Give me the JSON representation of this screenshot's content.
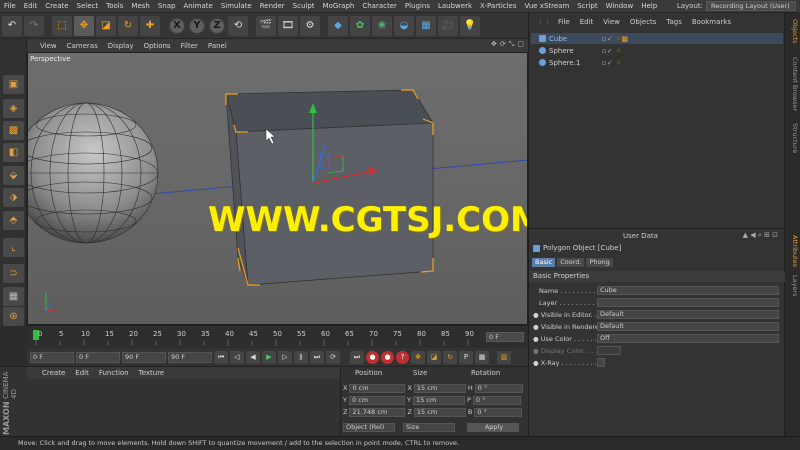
{
  "menubar": {
    "items": [
      "File",
      "Edit",
      "Create",
      "Select",
      "Tools",
      "Mesh",
      "Snap",
      "Animate",
      "Simulate",
      "Render",
      "Sculpt",
      "MoGraph",
      "Character",
      "Plugins",
      "Laubwerk",
      "X-Particles",
      "Vue xStream",
      "Script",
      "Window",
      "Help"
    ],
    "layout_label": "Layout:",
    "layout_value": "Recording Layout (User)"
  },
  "toolbar": {
    "x": "X",
    "y": "Y",
    "z": "Z"
  },
  "viewport": {
    "menu": [
      "View",
      "Cameras",
      "Display",
      "Options",
      "Filter",
      "Panel"
    ],
    "label": "Perspective",
    "watermark": "WWW.CGTSJ.COM"
  },
  "timeline": {
    "ticks": [
      "0",
      "5",
      "10",
      "15",
      "20",
      "25",
      "30",
      "35",
      "40",
      "45",
      "50",
      "55",
      "60",
      "65",
      "70",
      "75",
      "80",
      "85",
      "90"
    ],
    "current_frame": "0 F"
  },
  "transport": {
    "start": "0 F",
    "preview_start": "0 F",
    "preview_end": "90 F",
    "end": "90 F"
  },
  "materials": {
    "menu": [
      "Create",
      "Edit",
      "Function",
      "Texture"
    ],
    "logo_top": "MAXON",
    "logo_bottom": "CINEMA 4D"
  },
  "coordinates": {
    "headers": [
      "Position",
      "Size",
      "Rotation"
    ],
    "rows": [
      {
        "axis": "X",
        "pos": "0 cm",
        "size_axis": "X",
        "size": "15 cm",
        "rot_axis": "H",
        "rot": "0 °"
      },
      {
        "axis": "Y",
        "pos": "0 cm",
        "size_axis": "Y",
        "size": "15 cm",
        "rot_axis": "P",
        "rot": "0 °"
      },
      {
        "axis": "Z",
        "pos": "21.748 cm",
        "size_axis": "Z",
        "size": "15 cm",
        "rot_axis": "B",
        "rot": "0 °"
      }
    ],
    "mode": "Object (Rel)",
    "size_mode": "Size",
    "apply": "Apply"
  },
  "objects": {
    "menu": [
      "File",
      "Edit",
      "View",
      "Objects",
      "Tags",
      "Bookmarks"
    ],
    "items": [
      {
        "name": "Cube",
        "selected": true
      },
      {
        "name": "Sphere",
        "selected": false
      },
      {
        "name": "Sphere.1",
        "selected": false
      }
    ]
  },
  "side_tabs": [
    "Objects",
    "Content Browser",
    "Structure",
    "Attributes",
    "Layers"
  ],
  "attributes": {
    "menu_tail": "User Data",
    "object_title": "Polygon Object [Cube]",
    "tabs": [
      {
        "label": "Basic",
        "active": true
      },
      {
        "label": "Coord.",
        "active": false
      },
      {
        "label": "Phong",
        "active": false
      }
    ],
    "section": "Basic Properties",
    "fields": [
      {
        "label": "Name . . . . . . . . . . .",
        "value": "Cube"
      },
      {
        "label": "Layer . . . . . . . . . . .",
        "value": ""
      },
      {
        "label": "Visible in Editor. . .",
        "value": "Default"
      },
      {
        "label": "Visible in Renderer",
        "value": "Default"
      },
      {
        "label": "Use Color . . . . . . .",
        "value": "Off"
      },
      {
        "label": "Display Color. . . .",
        "value": ""
      },
      {
        "label": "X-Ray . . . . . . . . . .",
        "value": ""
      }
    ]
  },
  "status": "Move: Click and drag to move elements. Hold down SHIFT to quantize movement / add to the selection in point mode, CTRL to remove."
}
